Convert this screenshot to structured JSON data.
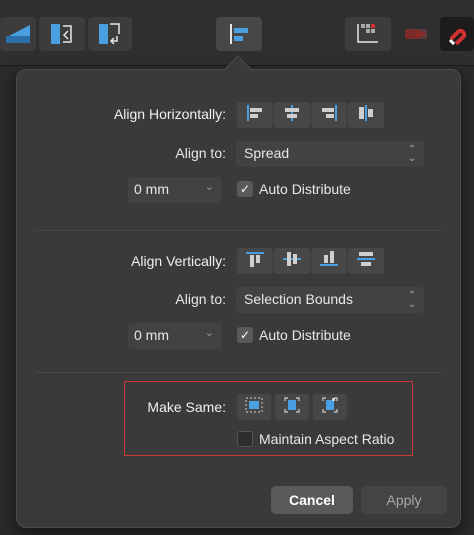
{
  "toolbar": {
    "buttons": [
      {
        "name": "send-backward-icon"
      },
      {
        "name": "move-back-one-icon"
      },
      {
        "name": "move-forward-one-icon"
      },
      {
        "name": "align-icon"
      },
      {
        "name": "transform-origin-icon"
      },
      {
        "name": "flip-icon"
      },
      {
        "name": "snapping-magnet-icon"
      }
    ],
    "accent_color": "#4a9fe0",
    "magnet_color": "#d23030"
  },
  "align_horizontal": {
    "label": "Align Horizontally:",
    "icons": [
      "align-left-icon",
      "align-center-icon",
      "align-right-icon",
      "space-horizontal-icon"
    ],
    "align_to_label": "Align to:",
    "align_to_value": "Spread",
    "spacing_value": "0 mm",
    "auto_distribute_label": "Auto Distribute",
    "auto_distribute_checked": true
  },
  "align_vertical": {
    "label": "Align Vertically:",
    "icons": [
      "align-top-icon",
      "align-middle-icon",
      "align-bottom-icon",
      "space-vertical-icon"
    ],
    "align_to_label": "Align to:",
    "align_to_value": "Selection Bounds",
    "spacing_value": "0 mm",
    "auto_distribute_label": "Auto Distribute",
    "auto_distribute_checked": true
  },
  "make_same": {
    "label": "Make Same:",
    "icons": [
      "same-size-icon",
      "same-height-icon",
      "same-width-icon"
    ],
    "maintain_aspect_label": "Maintain Aspect Ratio",
    "maintain_aspect_checked": false
  },
  "footer": {
    "cancel_label": "Cancel",
    "apply_label": "Apply"
  }
}
